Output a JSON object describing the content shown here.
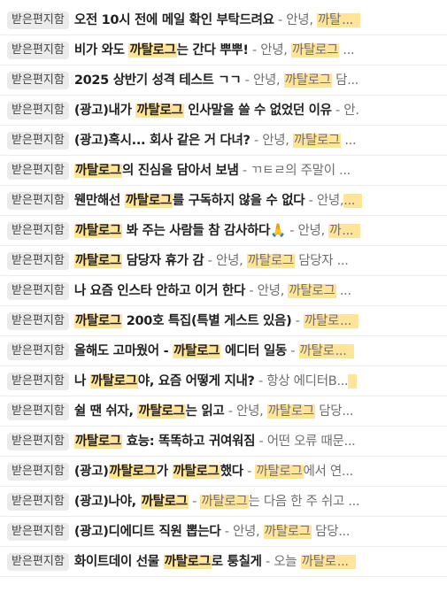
{
  "highlight_color": "#ffe49a",
  "badge_color": "#ebebeb",
  "emails": [
    {
      "folder": "받은편지함",
      "subject": [
        {
          "t": "오전 10시 전에 메일 확인 부탁드려요"
        }
      ],
      "separator": " - ",
      "preview": [
        {
          "t": "안녕, "
        },
        {
          "t": "까탈",
          "h": true
        }
      ],
      "ellipsis": "...",
      "ellipsis_highlight": true
    },
    {
      "folder": "받은편지함",
      "subject": [
        {
          "t": "비가 와도 "
        },
        {
          "t": "까탈로그",
          "h": true
        },
        {
          "t": "는 간다 뿌뿌!"
        }
      ],
      "separator": " - ",
      "preview": [
        {
          "t": "안녕, "
        },
        {
          "t": "까탈로그",
          "h": true
        },
        {
          "t": " "
        }
      ],
      "ellipsis": "...",
      "ellipsis_highlight": false
    },
    {
      "folder": "받은편지함",
      "subject": [
        {
          "t": "2025 상반기 성격 테스트 ㄱㄱ"
        }
      ],
      "separator": " - ",
      "preview": [
        {
          "t": "안녕, "
        },
        {
          "t": "까탈로그",
          "h": true
        },
        {
          "t": " 담"
        }
      ],
      "ellipsis": "...",
      "ellipsis_highlight": false
    },
    {
      "folder": "받은편지함",
      "subject": [
        {
          "t": "(광고)내가 "
        },
        {
          "t": "까탈로그",
          "h": true
        },
        {
          "t": " 인사말을 쓸 수 없었던 이유"
        }
      ],
      "separator": " - ",
      "preview": [
        {
          "t": "안."
        }
      ],
      "ellipsis": "",
      "ellipsis_highlight": false
    },
    {
      "folder": "받은편지함",
      "subject": [
        {
          "t": "(광고)혹시... 회사 같은 거 다녀?"
        }
      ],
      "separator": " - ",
      "preview": [
        {
          "t": "안녕, "
        },
        {
          "t": "까탈로그",
          "h": true
        },
        {
          "t": " "
        }
      ],
      "ellipsis": "...",
      "ellipsis_highlight": false
    },
    {
      "folder": "받은편지함",
      "subject": [
        {
          "t": "까탈로그",
          "h": true
        },
        {
          "t": "의 진심을 담아서 보냄"
        }
      ],
      "separator": " - ",
      "preview": [
        {
          "t": "ㄲㅌㄹ의 주말이 "
        }
      ],
      "ellipsis": "...",
      "ellipsis_highlight": false
    },
    {
      "folder": "받은편지함",
      "subject": [
        {
          "t": "웬만해선 "
        },
        {
          "t": "까탈로그",
          "h": true
        },
        {
          "t": "를 구독하지 않을 수 없다"
        }
      ],
      "separator": " - ",
      "preview": [
        {
          "t": "안녕,"
        }
      ],
      "ellipsis": "...",
      "ellipsis_highlight": true
    },
    {
      "folder": "받은편지함",
      "subject": [
        {
          "t": "까탈로그",
          "h": true
        },
        {
          "t": " 봐 주는 사람들 참 감사하다🙏"
        }
      ],
      "separator": " - ",
      "preview": [
        {
          "t": "안녕, "
        },
        {
          "t": "까",
          "h": true
        }
      ],
      "ellipsis": "...",
      "ellipsis_highlight": true
    },
    {
      "folder": "받은편지함",
      "subject": [
        {
          "t": "까탈로그",
          "h": true
        },
        {
          "t": " 담당자 휴가 감"
        }
      ],
      "separator": " - ",
      "preview": [
        {
          "t": "안녕, "
        },
        {
          "t": "까탈로그",
          "h": true
        },
        {
          "t": " 담당자 "
        }
      ],
      "ellipsis": "...",
      "ellipsis_highlight": false
    },
    {
      "folder": "받은편지함",
      "subject": [
        {
          "t": "나 요즘 인스타 안하고 이거 한다"
        }
      ],
      "separator": " - ",
      "preview": [
        {
          "t": "안녕, "
        },
        {
          "t": "까탈로그",
          "h": true
        },
        {
          "t": " "
        }
      ],
      "ellipsis": "...",
      "ellipsis_highlight": false
    },
    {
      "folder": "받은편지함",
      "subject": [
        {
          "t": "까탈로그",
          "h": true
        },
        {
          "t": " 200호 특집(특별 게스트 있음)"
        }
      ],
      "separator": " - ",
      "preview": [
        {
          "t": "까탈로",
          "h": true
        }
      ],
      "ellipsis": "...",
      "ellipsis_highlight": true
    },
    {
      "folder": "받은편지함",
      "subject": [
        {
          "t": "올해도 고마웠어 - "
        },
        {
          "t": "까탈로그",
          "h": true
        },
        {
          "t": " 에디터 일동"
        }
      ],
      "separator": " - ",
      "preview": [
        {
          "t": "까탈로",
          "h": true
        }
      ],
      "ellipsis": "...",
      "ellipsis_highlight": true
    },
    {
      "folder": "받은편지함",
      "subject": [
        {
          "t": "나 "
        },
        {
          "t": "까탈로그",
          "h": true
        },
        {
          "t": "야, 요즘 어떻게 지내?"
        }
      ],
      "separator": " - ",
      "preview": [
        {
          "t": "항상 에디터B..."
        }
      ],
      "ellipsis": " ",
      "ellipsis_highlight": true
    },
    {
      "folder": "받은편지함",
      "subject": [
        {
          "t": "쉴 땐 쉬자, "
        },
        {
          "t": "까탈로그",
          "h": true
        },
        {
          "t": "는 읽고"
        }
      ],
      "separator": " - ",
      "preview": [
        {
          "t": "안녕, "
        },
        {
          "t": "까탈로그",
          "h": true
        },
        {
          "t": " 담당"
        }
      ],
      "ellipsis": "...",
      "ellipsis_highlight": false
    },
    {
      "folder": "받은편지함",
      "subject": [
        {
          "t": "까탈로그",
          "h": true
        },
        {
          "t": " 효능: 똑똑하고 귀여워짐"
        }
      ],
      "separator": " - ",
      "preview": [
        {
          "t": "어떤 오류 때문"
        }
      ],
      "ellipsis": "...",
      "ellipsis_highlight": false
    },
    {
      "folder": "받은편지함",
      "subject": [
        {
          "t": "(광고)"
        },
        {
          "t": "까탈로그",
          "h": true
        },
        {
          "t": "가 "
        },
        {
          "t": "까탈로그",
          "h": true
        },
        {
          "t": "했다"
        }
      ],
      "separator": " - ",
      "preview": [
        {
          "t": "까탈로그",
          "h": true
        },
        {
          "t": "에서 연"
        }
      ],
      "ellipsis": "...",
      "ellipsis_highlight": false
    },
    {
      "folder": "받은편지함",
      "subject": [
        {
          "t": "(광고)나야, "
        },
        {
          "t": "까탈로그",
          "h": true
        }
      ],
      "separator": " - ",
      "preview": [
        {
          "t": "까탈로그",
          "h": true
        },
        {
          "t": "는 다음 한 주 쉬고 "
        }
      ],
      "ellipsis": "...",
      "ellipsis_highlight": false
    },
    {
      "folder": "받은편지함",
      "subject": [
        {
          "t": "(광고)디에디트 직원 뽑는다"
        }
      ],
      "separator": " - ",
      "preview": [
        {
          "t": "안녕, "
        },
        {
          "t": "까탈로그",
          "h": true
        },
        {
          "t": " 담당"
        }
      ],
      "ellipsis": "...",
      "ellipsis_highlight": false
    },
    {
      "folder": "받은편지함",
      "subject": [
        {
          "t": "화이트데이 선물 "
        },
        {
          "t": "까탈로그",
          "h": true
        },
        {
          "t": "로 퉁칠게"
        }
      ],
      "separator": " - ",
      "preview": [
        {
          "t": "오늘 "
        },
        {
          "t": "까탈로",
          "h": true
        }
      ],
      "ellipsis": "...",
      "ellipsis_highlight": true
    }
  ]
}
